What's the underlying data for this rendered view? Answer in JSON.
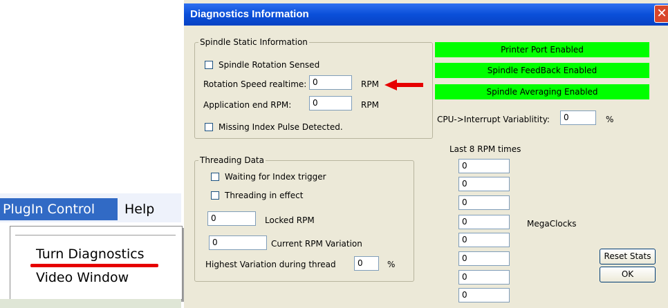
{
  "menu": {
    "plugin_control": "PlugIn Control",
    "help": "Help",
    "items": [
      "Turn Diagnostics",
      "Video Window"
    ]
  },
  "dialog": {
    "title": "Diagnostics Information",
    "spindle": {
      "group_label": "Spindle Static Information",
      "rotation_sensed_label": "Spindle Rotation Sensed",
      "rotation_speed_label": "Rotation Speed realtime:",
      "rotation_speed_value": "0",
      "application_end_label": "Application end RPM:",
      "application_end_value": "0",
      "rpm_unit": "RPM",
      "missing_index_label": "Missing Index Pulse Detected."
    },
    "status": {
      "printer_port": "Printer Port Enabled",
      "feedback": "Spindle FeedBack Enabled",
      "averaging": "Spindle Averaging Enabled",
      "color": "#00ff00"
    },
    "cpu": {
      "label": "CPU->Interrupt Variablitity:",
      "value": "0",
      "unit": "%"
    },
    "threading": {
      "group_label": "Threading Data",
      "waiting_label": "Waiting for Index trigger",
      "in_effect_label": "Threading in effect",
      "locked_value": "0",
      "locked_label": "Locked RPM",
      "variation_value": "0",
      "variation_label": "Current RPM Variation",
      "highest_label": "Highest Variation during thread",
      "highest_value": "0",
      "highest_unit": "%"
    },
    "rpm_times": {
      "label": "Last 8 RPM times",
      "values": [
        "0",
        "0",
        "0",
        "0",
        "0",
        "0",
        "0",
        "0"
      ],
      "unit": "MegaClocks"
    },
    "buttons": {
      "reset": "Reset Stats",
      "ok": "OK"
    }
  },
  "colors": {
    "annotation_red": "#e60000",
    "title_blue": "#0a4fd9",
    "dialog_face": "#ece9d8"
  }
}
